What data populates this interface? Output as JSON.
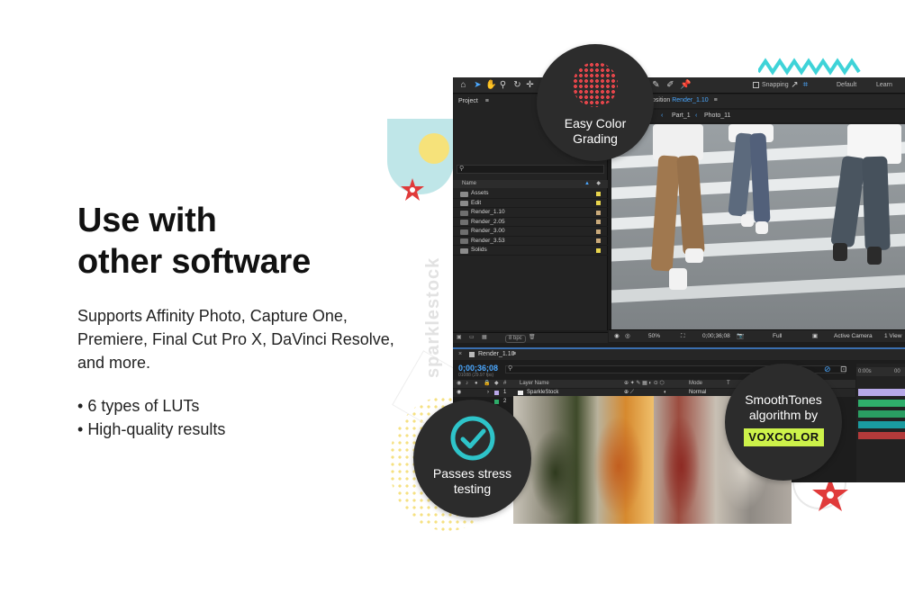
{
  "heading": {
    "line1": "Use with",
    "line2": "other software"
  },
  "description": "Supports Affinity Photo, Capture One, Premiere, Final Cut Pro X, DaVinci Resolve, and more.",
  "bullets": [
    "6 types of LUTs",
    "High-quality results"
  ],
  "watermark": "sparklestock",
  "badges": {
    "color_grading": {
      "line1": "Easy Color",
      "line2": "Grading"
    },
    "stress": {
      "line1": "Passes stress",
      "line2": "testing"
    },
    "smooth": {
      "line1": "SmoothTones",
      "line2": "algorithm by",
      "brand": "VOXCOLOR"
    }
  },
  "editor": {
    "topbar": {
      "snapping": "Snapping",
      "workspace_default": "Default",
      "workspace_learn": "Learn"
    },
    "project_panel": {
      "title": "Project",
      "column_name": "Name",
      "items": [
        {
          "name": "Assets",
          "swatch": "#e8d44d"
        },
        {
          "name": "Edit",
          "swatch": "#e8d44d"
        },
        {
          "name": "Render_1.10",
          "swatch": "#c9a97a"
        },
        {
          "name": "Render_2.05",
          "swatch": "#c9a97a"
        },
        {
          "name": "Render_3.00",
          "swatch": "#c9a97a"
        },
        {
          "name": "Render_3.53",
          "swatch": "#c9a97a"
        },
        {
          "name": "Solids",
          "swatch": "#e8d44d"
        }
      ],
      "bpc": "8 bpc"
    },
    "composition": {
      "label": "osition",
      "active_comp": "Render_1.10",
      "breadcrumb1": "Part_1",
      "breadcrumb2": "Photo_11"
    },
    "viewer_controls": {
      "zoom": "50%",
      "timecode": "0;00;36;08",
      "resolution": "Full",
      "camera": "Active Camera",
      "views": "1 View"
    },
    "timeline": {
      "tab": "Render_1.10",
      "timecode": "0;00;36;08",
      "timecode_sub": "01088 (29.97 fps)",
      "col_layer_name": "Layer Name",
      "col_mode": "Mode",
      "col_t": "T",
      "layer1_index": "1",
      "layer1_name": "SparkleStock",
      "layer1_mode": "Normal",
      "layer2_index": "2",
      "ruler_start": "0:00s",
      "ruler_next": "00"
    }
  },
  "colors": {
    "accent_blue": "#4ba8ff",
    "badge_bg": "#2c2c2c",
    "voxcolor_green": "#cdf24a",
    "dot_red": "#e2454a",
    "teal": "#2ec4c9",
    "star_red": "#e03a3a"
  }
}
